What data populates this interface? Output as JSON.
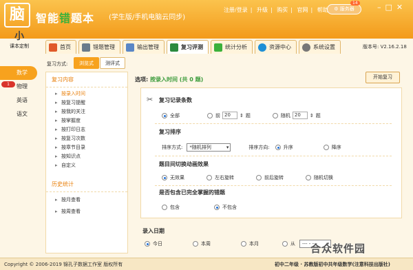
{
  "app": {
    "logo_char": "脑",
    "title_a": "智能",
    "title_hl": "错",
    "title_b": "题本",
    "subtitle": "(学生版/手机电脑云同步)",
    "top_links": [
      "注册/登录",
      "|",
      "升级",
      "|",
      "购买",
      "|",
      "官网",
      "|",
      "帮助"
    ],
    "service_btn": "服务器",
    "service_badge": "14",
    "brand_icon": "小",
    "brand_label": "课本定制",
    "version": "版本号: V2.16.2.18"
  },
  "tabs": [
    {
      "label": "首页",
      "icon_color": "#e05a2a"
    },
    {
      "label": "错题管理",
      "icon_color": "#6a7b8c"
    },
    {
      "label": "输出管理",
      "icon_color": "#5a86c6"
    },
    {
      "label": "复习评测",
      "icon_color": "#2b8a3e"
    },
    {
      "label": "统计分析",
      "icon_color": "#3bb13b"
    },
    {
      "label": "资源中心",
      "icon_color": "#1e8fd6"
    },
    {
      "label": "系统设置",
      "icon_color": "#777777"
    }
  ],
  "subjects": [
    "数学",
    "物理",
    "英语",
    "语文"
  ],
  "subject_badge": "1",
  "review_mode": {
    "label": "复习方式:",
    "options": [
      "浏览式",
      "测评式"
    ]
  },
  "left_panel": {
    "review_title": "复习内容",
    "review_items": [
      "按录入时间",
      "按复习提醒",
      "按我的关注",
      "按掌握度",
      "按打印日志",
      "按复习次数",
      "按章节目录",
      "按知识点",
      "自定义"
    ],
    "history_title": "历史统计",
    "history_items": [
      "按月查看",
      "按周查看"
    ]
  },
  "options": {
    "label": "选项:",
    "value": "按录入时间 (共 0 题)",
    "start_btn": "开始复习"
  },
  "sections": {
    "count_title": "复习记录条数",
    "count_all": "全部",
    "count_front": "前",
    "count_front_val": "20",
    "count_unit": "题",
    "count_random": "随机",
    "count_random_val": "20",
    "sort_title": "复习排序",
    "sort_method_label": "排序方式:",
    "sort_method_val": "*随机排列",
    "sort_dir_label": "排序方向:",
    "sort_asc": "升序",
    "sort_desc": "降序",
    "anim_title": "题目间切换动画效果",
    "anim_opts": [
      "无效果",
      "左右旋转",
      "前后旋转",
      "随机切换"
    ],
    "mastered_title": "是否包含已完全掌握的错题",
    "mastered_opts": [
      "包含",
      "不包含"
    ]
  },
  "date": {
    "title": "录入日期",
    "opts": [
      "今日",
      "本周",
      "本月"
    ],
    "from": "从",
    "from_val": "--- - ---"
  },
  "status": {
    "copyright": "Copyright © 2006-2019 锦孔子数据工作室 版权所有",
    "info": "初中二年级 · 苏教版初中共年级数学(注意科技出版社)"
  },
  "watermark": "合众软件园"
}
